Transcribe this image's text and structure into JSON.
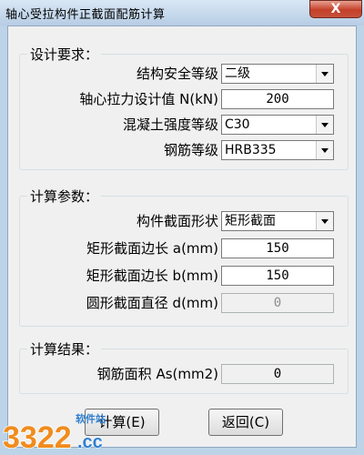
{
  "window": {
    "title": "轴心受拉构件正截面配筋计算",
    "close_glyph": "X"
  },
  "design": {
    "title": "设计要求：",
    "safety_label": "结构安全等级",
    "safety_value": "二级",
    "force_label": "轴心拉力设计值 N(kN)",
    "force_value": "200",
    "concrete_label": "混凝土强度等级",
    "concrete_value": "C30",
    "rebar_label": "钢筋等级",
    "rebar_value": "HRB335"
  },
  "params": {
    "title": "计算参数：",
    "shape_label": "构件截面形状",
    "shape_value": "矩形截面",
    "a_label": "矩形截面边长 a(mm)",
    "a_value": "150",
    "b_label": "矩形截面边长 b(mm)",
    "b_value": "150",
    "d_label": "圆形截面直径 d(mm)",
    "d_value": "0"
  },
  "result": {
    "title": "计算结果：",
    "area_label": "钢筋面积 As(mm2)",
    "area_value": "0"
  },
  "buttons": {
    "calc": "计算(E)",
    "back": "返回(C)"
  },
  "watermark": {
    "number": "3322",
    "site": "软件站",
    "domain": ".cc"
  },
  "colors": {
    "close_red": "#c4402a",
    "titlebar": "#b7cde4",
    "logo_orange": "#f08c1e",
    "logo_blue": "#2f7fd0"
  }
}
